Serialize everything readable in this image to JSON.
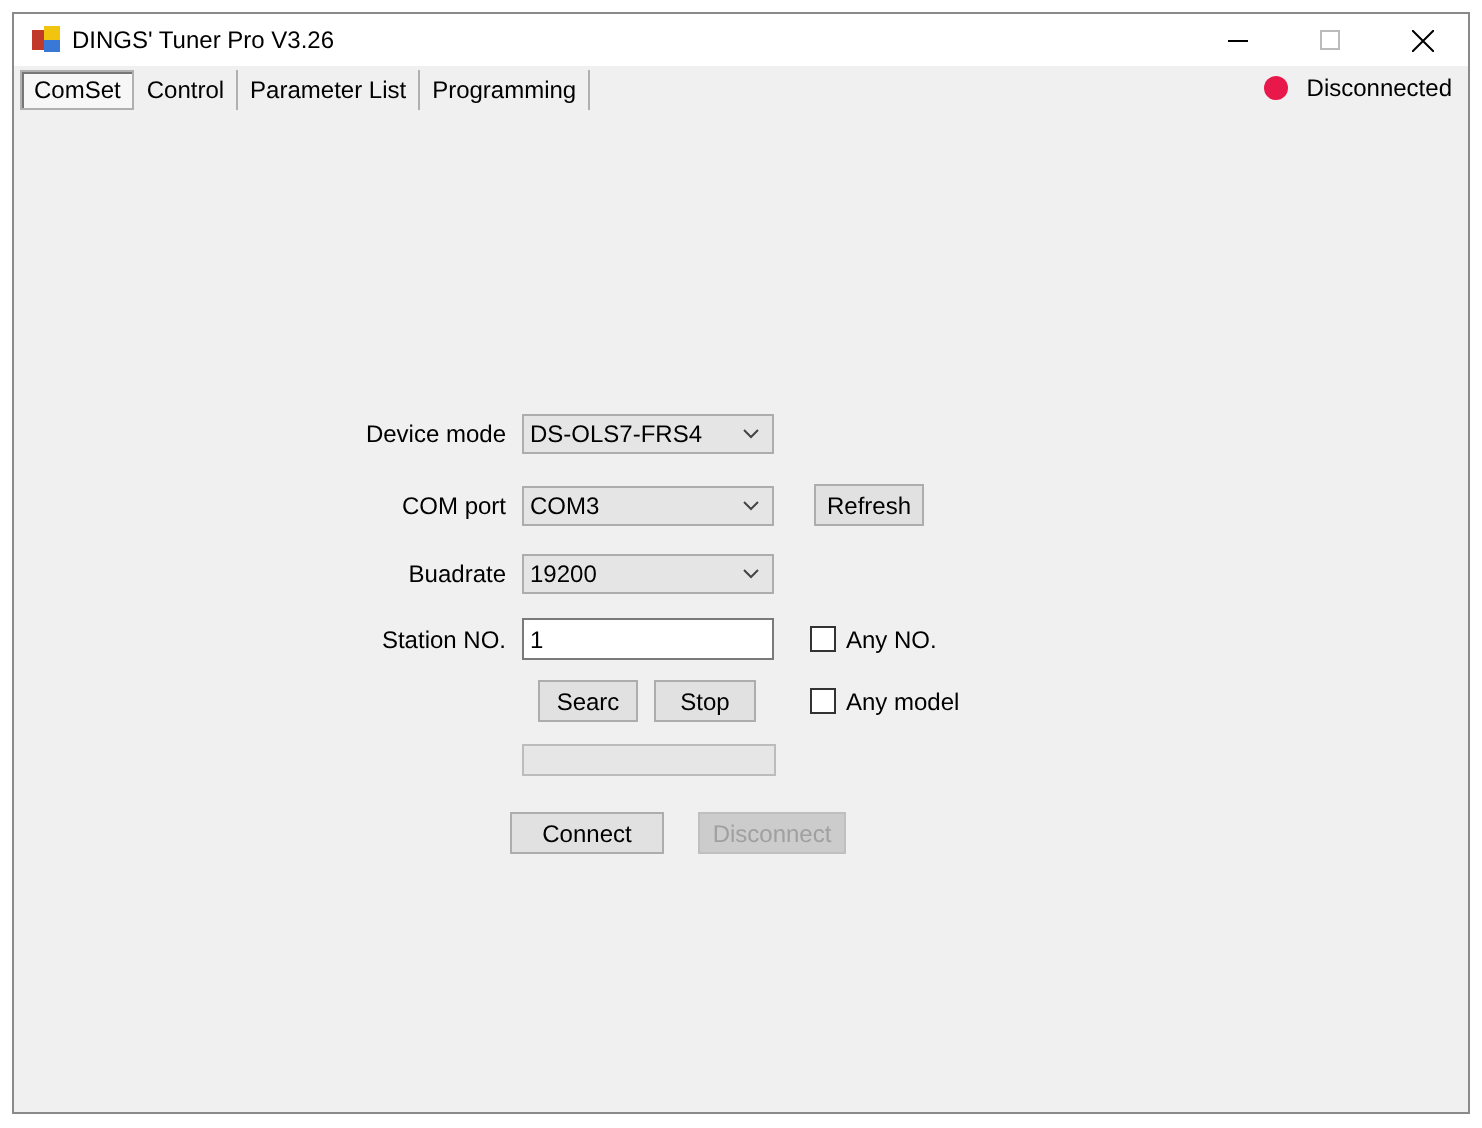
{
  "window": {
    "title": "DINGS' Tuner Pro V3.26"
  },
  "tabs": [
    {
      "label": "ComSet",
      "selected": true
    },
    {
      "label": "Control",
      "selected": false
    },
    {
      "label": "Parameter List",
      "selected": false
    },
    {
      "label": "Programming",
      "selected": false
    }
  ],
  "status": {
    "label": "Disconnected",
    "color": "#e8194a"
  },
  "form": {
    "device_mode": {
      "label": "Device mode",
      "value": "DS-OLS7-FRS4"
    },
    "com_port": {
      "label": "COM port",
      "value": "COM3"
    },
    "refresh_button": "Refresh",
    "baudrate": {
      "label": "Buadrate",
      "value": "19200"
    },
    "station": {
      "label": "Station NO.",
      "value": "1"
    },
    "any_no": {
      "label": "Any NO.",
      "checked": false
    },
    "search_button": "Searc",
    "stop_button": "Stop",
    "any_model": {
      "label": "Any model",
      "checked": false
    },
    "progress": {
      "level": 0
    },
    "connect_button": {
      "label": "Connect",
      "disabled": false
    },
    "disconnect_button": {
      "label": "Disconnect",
      "disabled": true
    }
  }
}
